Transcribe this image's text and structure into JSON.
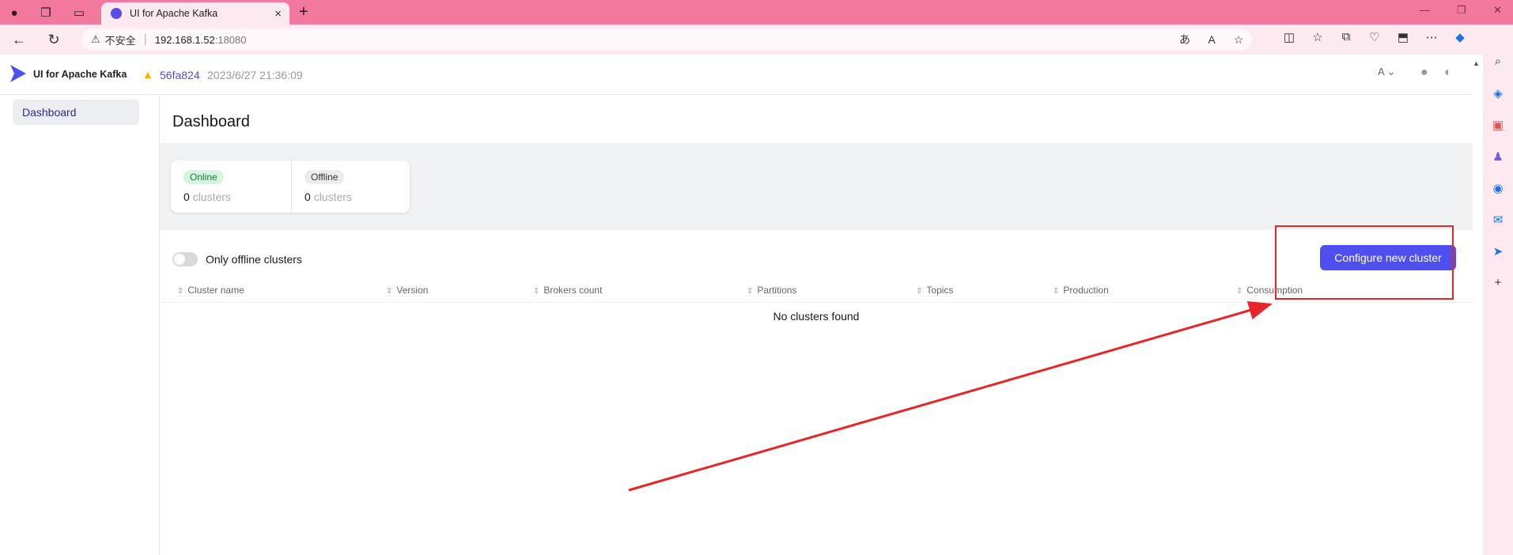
{
  "browser": {
    "tab_title": "UI for Apache Kafka",
    "new_tab": "+",
    "window_controls": [
      "—",
      "❐",
      "✕"
    ],
    "address": {
      "security_label": "不安全",
      "host": "192.168.1.52",
      "port": ":18080"
    }
  },
  "app": {
    "title": "UI for Apache Kafka",
    "version_hash": "56fa824",
    "version_date": "2023/6/27 21:36:09",
    "user_initial": "A"
  },
  "sidebar": {
    "items": [
      {
        "label": "Dashboard"
      }
    ]
  },
  "dashboard": {
    "title": "Dashboard",
    "metrics": [
      {
        "badge": "Online",
        "count": "0",
        "unit": "clusters"
      },
      {
        "badge": "Offline",
        "count": "0",
        "unit": "clusters"
      }
    ],
    "toggle_label": "Only offline clusters",
    "configure_button": "Configure new cluster",
    "columns": [
      "Cluster name",
      "Version",
      "Brokers count",
      "Partitions",
      "Topics",
      "Production",
      "Consumption"
    ],
    "empty_text": "No clusters found"
  },
  "colors": {
    "accent": "#4f4ff0",
    "annotation": "#e8262a",
    "browser_chrome": "#f3789f"
  }
}
